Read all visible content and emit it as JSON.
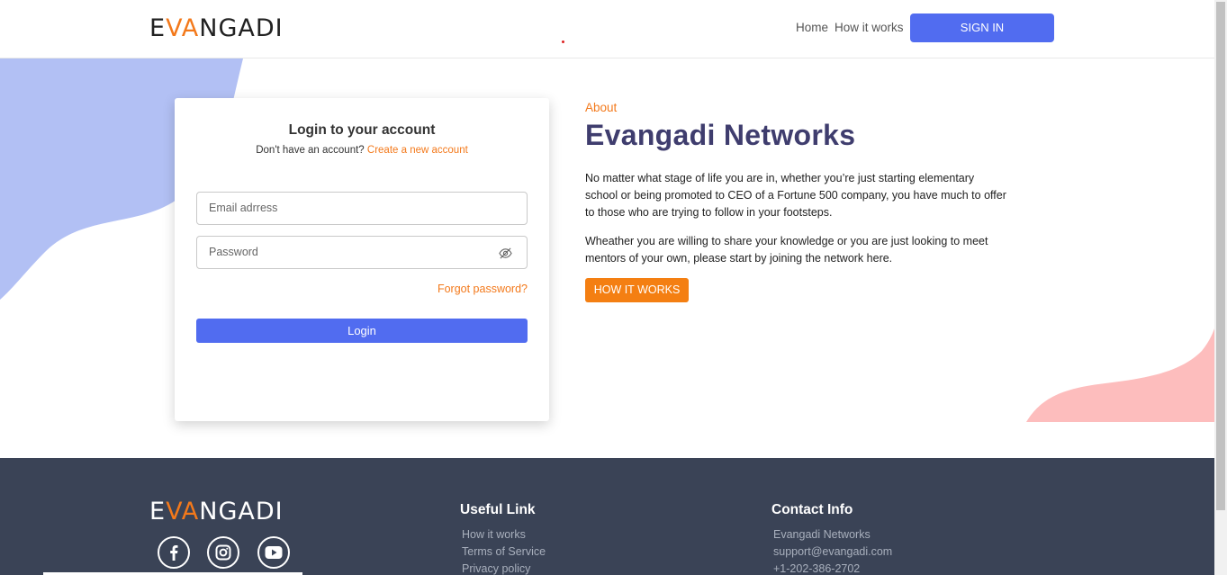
{
  "header": {
    "logo_prefix": "E",
    "logo_highlight": "VA",
    "logo_suffix": "NGADI",
    "nav": {
      "home": "Home",
      "how_it_works": "How it works",
      "sign_in": "SIGN IN"
    }
  },
  "login": {
    "title": "Login to your account",
    "subtitle_prefix": "Don't have an account?",
    "create_link": "Create a new account",
    "email_placeholder": "Email adrress",
    "password_placeholder": "Password",
    "forgot": "Forgot password?",
    "login_button": "Login"
  },
  "about": {
    "label": "About",
    "title": "Evangadi Networks",
    "paragraph1": "No matter what stage of life you are in, whether you’re just starting elementary school or being promoted to CEO of a Fortune 500 company, you have much to offer to those who are trying to follow in your footsteps.",
    "paragraph2": "Wheather you are willing to share your knowledge or you are just looking to meet mentors of your own, please start by joining the network here.",
    "button": "HOW IT WORKS"
  },
  "footer": {
    "logo_prefix": "E",
    "logo_highlight": "VA",
    "logo_suffix": "NGADI",
    "social_icons": [
      "facebook-icon",
      "instagram-icon",
      "youtube-icon"
    ],
    "useful_link": {
      "heading": "Useful Link",
      "items": [
        "How it works",
        "Terms of Service",
        "Privacy policy"
      ]
    },
    "contact": {
      "heading": "Contact Info",
      "items": [
        "Evangadi Networks",
        "support@evangadi.com",
        "+1-202-386-2702"
      ]
    }
  },
  "colors": {
    "accent_orange": "#f3791b",
    "primary_blue": "#516cf0",
    "title_purple": "#3f3d6e",
    "footer_bg": "#3a4356"
  }
}
